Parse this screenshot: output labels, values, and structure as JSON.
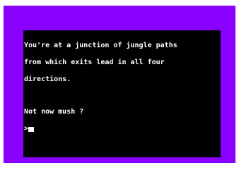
{
  "game": {
    "description_lines": [
      "You're at a junction of jungle paths",
      "from which exits lead in all four",
      "directions."
    ],
    "response": "Not now mush ?",
    "prompt": ">"
  },
  "colors": {
    "border": "#8a00ff",
    "screen": "#000000",
    "text": "#ffffff"
  }
}
